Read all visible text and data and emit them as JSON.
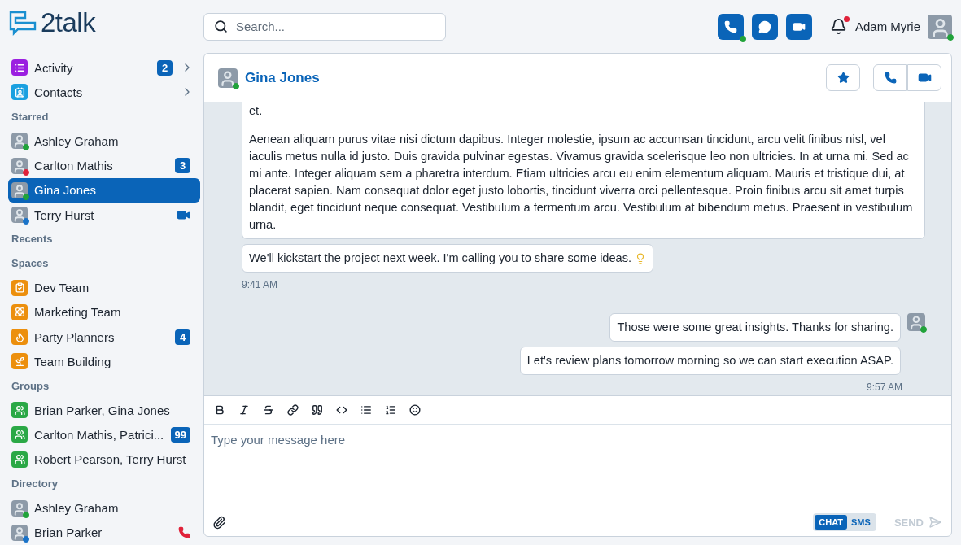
{
  "app": {
    "logo": "2talk"
  },
  "search": {
    "placeholder": "Search..."
  },
  "topbar": {
    "actions": [
      {
        "kind": "phone",
        "color": "#21a33a"
      },
      {
        "kind": "chat"
      },
      {
        "kind": "video"
      }
    ],
    "notifications": {
      "unread": true
    },
    "user": {
      "name": "Adam Myrie",
      "color": "#21a33a"
    }
  },
  "sidebar": {
    "nav": [
      {
        "label": "Activity",
        "kind": "activity",
        "badge": "2",
        "selected": false
      },
      {
        "label": "Contacts",
        "kind": "contacts",
        "selected": false
      }
    ],
    "sections": [
      {
        "title": "Starred",
        "items": [
          {
            "label": "Ashley Graham",
            "kind": "person",
            "color": "#21a33a",
            "selected": false
          },
          {
            "label": "Carlton Mathis",
            "kind": "person",
            "color": "#e0223a",
            "badge": "3",
            "selected": false
          },
          {
            "label": "Gina Jones",
            "kind": "person",
            "color": "#21a33a",
            "selected": true
          },
          {
            "label": "Terry Hurst",
            "kind": "person",
            "color": "#1a73c9",
            "video_call": true,
            "selected": false
          }
        ]
      },
      {
        "title": "Recents"
      },
      {
        "title": "Spaces",
        "items": [
          {
            "label": "Dev Team",
            "kind": "space",
            "selected": false
          },
          {
            "label": "Marketing Team",
            "kind": "space",
            "selected": false
          },
          {
            "label": "Party Planners",
            "kind": "space",
            "badge": "4",
            "selected": false
          },
          {
            "label": "Team Building",
            "kind": "space",
            "selected": false
          }
        ]
      },
      {
        "title": "Groups",
        "items": [
          {
            "label": "Brian Parker, Gina Jones",
            "kind": "group",
            "selected": false
          },
          {
            "label": "Carlton Mathis, Patrici...",
            "kind": "group",
            "badge": "99",
            "selected": false
          },
          {
            "label": "Robert Pearson, Terry Hurst",
            "kind": "group",
            "selected": false
          }
        ]
      },
      {
        "title": "Directory",
        "items": [
          {
            "label": "Ashley Graham",
            "kind": "person",
            "color": "#21a33a",
            "selected": false
          },
          {
            "label": "Brian Parker",
            "kind": "person",
            "color": "#1a73c9",
            "phone_call": true,
            "selected": false
          }
        ]
      }
    ]
  },
  "chat": {
    "contact": {
      "name": "Gina Jones",
      "color": "#21a33a"
    },
    "groups": [
      {
        "outgoing": false,
        "messages": [
          {
            "paragraphs": [
              "et.",
              "Aenean aliquam purus vitae nisi dictum dapibus. Integer molestie, ipsum ac accumsan tincidunt, arcu velit finibus nisl, vel iaculis metus nulla id justo. Duis gravida pulvinar egestas. Vivamus gravida scelerisque leo non ultricies. In at urna mi. Sed ac mi ante. Integer aliquam sem a pharetra interdum. Etiam ultricies arcu eu enim elementum aliquam. Mauris et tristique dui, at placerat sapien. Nam consequat dolor eget justo lobortis, tincidunt viverra orci pellentesque. Proin finibus arcu sit amet turpis blandit, eget tincidunt neque consequat. Vestibulum a fermentum arcu. Vestibulum at bibendum metus. Praesent in vestibulum urna."
            ]
          },
          {
            "paragraphs": [
              "We'll kickstart the project next week. I'm calling you to share some ideas."
            ],
            "trailing_icon": true
          }
        ],
        "time": "9:41 AM"
      },
      {
        "outgoing": true,
        "messages": [
          {
            "paragraphs": [
              "Those were some great insights. Thanks for sharing."
            ]
          },
          {
            "paragraphs": [
              "Let's review plans tomorrow morning so we can start execution ASAP."
            ]
          }
        ],
        "time": "9:57 AM"
      }
    ],
    "composer": {
      "placeholder": "Type your message here",
      "modes": [
        {
          "label": "CHAT",
          "selected": true
        },
        {
          "label": "SMS",
          "selected": false
        }
      ],
      "send": {
        "label": "SEND",
        "disabled": true
      }
    }
  }
}
